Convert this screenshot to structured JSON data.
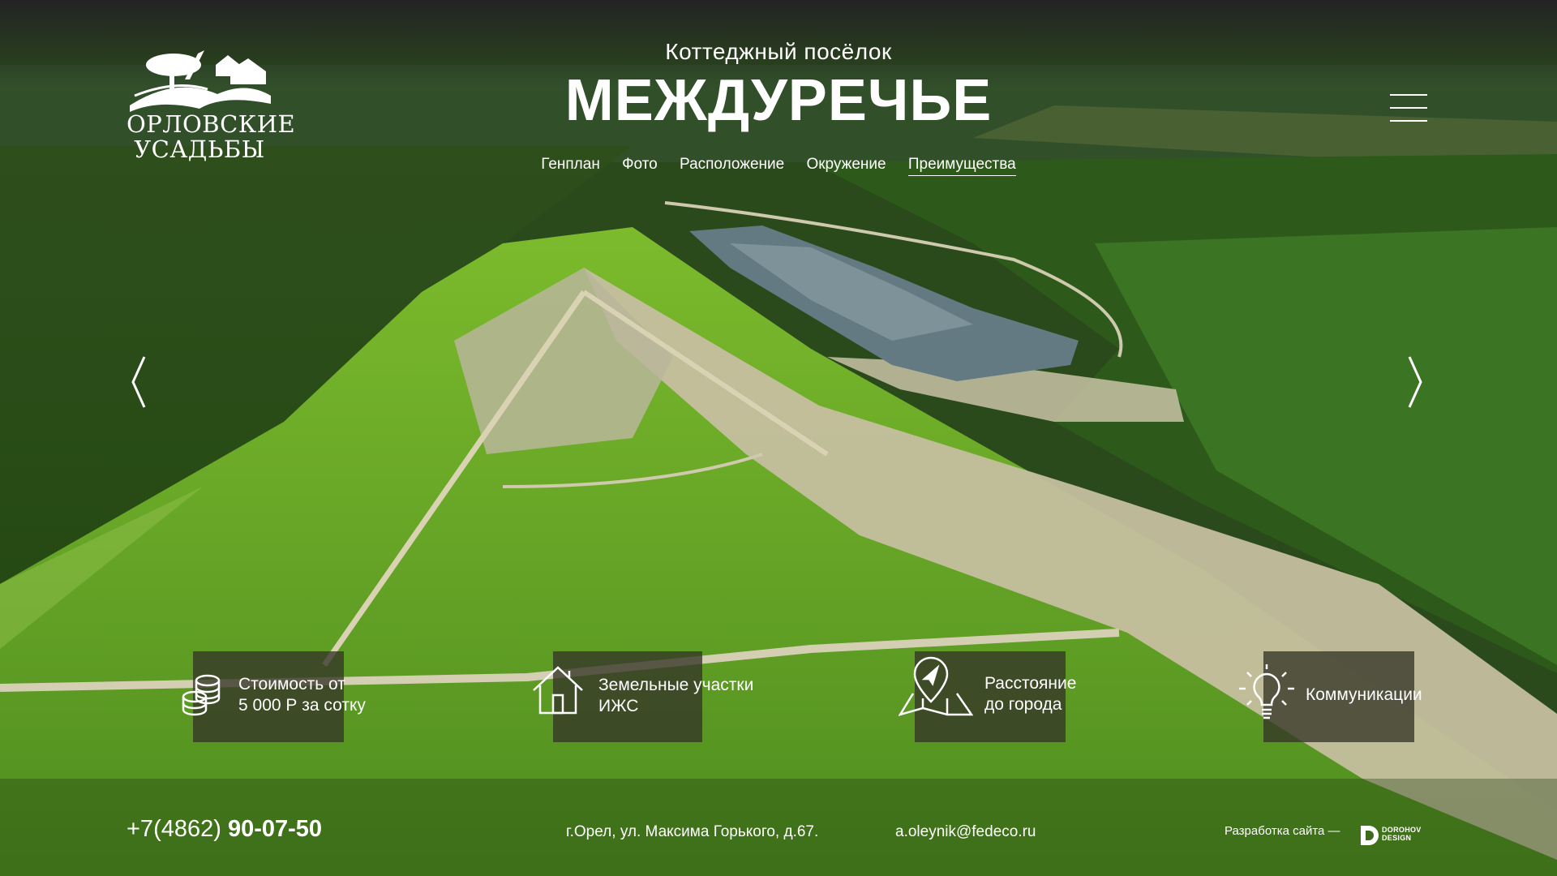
{
  "logo": {
    "line1": "ОРЛОВСКИЕ",
    "line2": "УСАДЬБЫ",
    "icon": "estate-hills-tree-icon"
  },
  "header": {
    "subtitle": "Коттеджный посёлок",
    "title": "МЕЖДУРЕЧЬЕ"
  },
  "nav": {
    "items": [
      "Генплан",
      "Фото",
      "Расположение",
      "Окружение",
      "Преимущества"
    ],
    "active": "Преимущества"
  },
  "menu_icon": "hamburger-menu-icon",
  "slider": {
    "prev_icon": "chevron-left-icon",
    "next_icon": "chevron-right-icon"
  },
  "features": [
    {
      "icon": "coins-stack-icon",
      "line1": "Стоимость от",
      "line2": "5 000 Р за сотку"
    },
    {
      "icon": "house-icon",
      "line1": "Земельные участки",
      "line2": "ИЖС"
    },
    {
      "icon": "map-pin-icon",
      "line1": "Расстояние",
      "line2": "до города"
    },
    {
      "icon": "lightbulb-icon",
      "line1": "Коммуникации",
      "line2": ""
    }
  ],
  "footer": {
    "phone_prefix": "+7(4862)",
    "phone_number": "90-07-50",
    "address": "г.Орел, ул. Максима Горького, д.67.",
    "email": "a.oleynik@fedeco.ru",
    "developer_label": "Разработка сайта —",
    "developer_logo_line1": "DOROHOV",
    "developer_logo_line2": "DESIGN"
  },
  "colors": {
    "sky_top": "#232323",
    "forest": "#2f5a17",
    "field": "#6fae2c",
    "dirt": "#c9c3a6",
    "lake": "#5f7379",
    "feature_box": "#34342a"
  }
}
